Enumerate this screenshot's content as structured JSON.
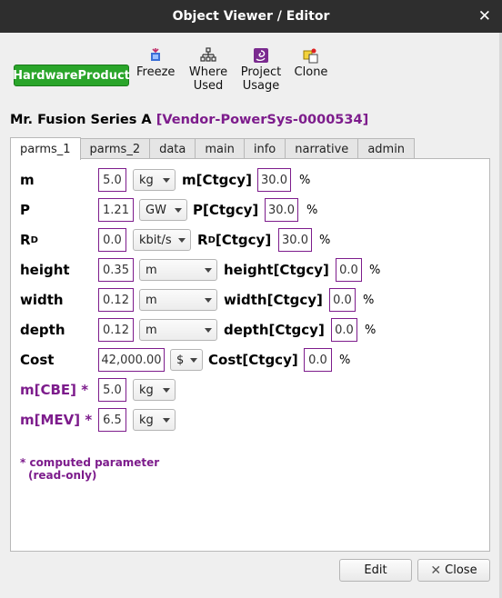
{
  "window": {
    "title": "Object Viewer / Editor"
  },
  "badge": "HardwareProduct",
  "toolbar": [
    {
      "name": "freeze",
      "label": "Freeze"
    },
    {
      "name": "where-used",
      "label": "Where Used"
    },
    {
      "name": "project-usage",
      "label": "Project Usage"
    },
    {
      "name": "clone",
      "label": "Clone"
    }
  ],
  "object": {
    "name": "Mr. Fusion Series A",
    "id": "[Vendor-PowerSys-0000534]"
  },
  "tabs": [
    "parms_1",
    "parms_2",
    "data",
    "main",
    "info",
    "narrative",
    "admin"
  ],
  "active_tab": "parms_1",
  "params": [
    {
      "label": "m",
      "value": "5.0",
      "unit": "kg",
      "ctgcy_label": "m[Ctgcy]",
      "ctgcy": "30.0",
      "pct": "%"
    },
    {
      "label": "P",
      "value": "1.21",
      "unit": "GW",
      "ctgcy_label": "P[Ctgcy]",
      "ctgcy": "30.0",
      "pct": "%"
    },
    {
      "label": "R",
      "sub": "D",
      "value": "0.0",
      "unit": "kbit/s",
      "ctgcy_label": "R",
      "ctgcy_sub": "D",
      "ctgcy_suffix": "[Ctgcy]",
      "ctgcy": "30.0",
      "pct": "%"
    },
    {
      "label": "height",
      "value": "0.35",
      "unit": "m",
      "ctgcy_label": "height[Ctgcy]",
      "ctgcy": "0.0",
      "pct": "%"
    },
    {
      "label": "width",
      "value": "0.12",
      "unit": "m",
      "ctgcy_label": "width[Ctgcy]",
      "ctgcy": "0.0",
      "pct": "%"
    },
    {
      "label": "depth",
      "value": "0.12",
      "unit": "m",
      "ctgcy_label": "depth[Ctgcy]",
      "ctgcy": "0.0",
      "pct": "%"
    },
    {
      "label": "Cost",
      "value": "42,000.00",
      "unit": "$",
      "ctgcy_label": "Cost[Ctgcy]",
      "ctgcy": "0.0",
      "pct": "%"
    }
  ],
  "computed": [
    {
      "label": "m[CBE] *",
      "value": "5.0",
      "unit": "kg"
    },
    {
      "label": "m[MEV] *",
      "value": "6.5",
      "unit": "kg"
    }
  ],
  "note": {
    "line1": "* computed parameter",
    "line2": "(read-only)"
  },
  "buttons": {
    "edit": "Edit",
    "close": "Close"
  },
  "colors": {
    "titlebar": "#2e2e2e",
    "badge": "#2aa52a",
    "accent": "#7d1c8c"
  }
}
